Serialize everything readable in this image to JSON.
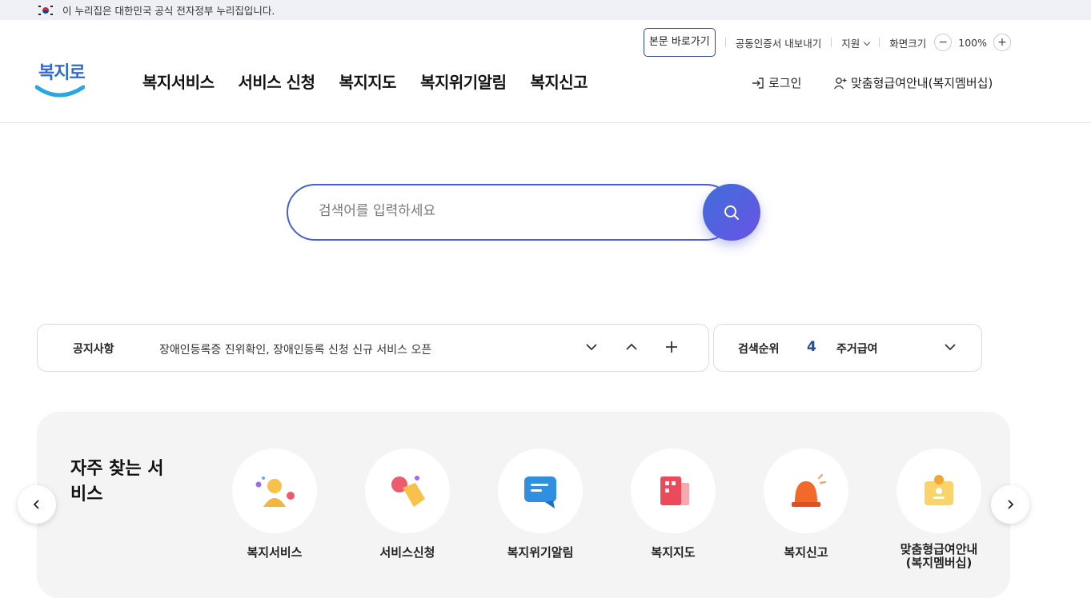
{
  "gov_banner": {
    "text": "이 누리집은 대한민국 공식 전자정부 누리집입니다."
  },
  "logo": {
    "text": "복지로"
  },
  "util": {
    "skip_label": "본문 바로가기",
    "cert_label": "공동인증서 내보내기",
    "support_label": "지원",
    "zoom_label": "화면크기",
    "zoom_out": "−",
    "zoom_value": "100%",
    "zoom_in": "+"
  },
  "nav": {
    "items": [
      {
        "label": "복지서비스"
      },
      {
        "label": "서비스 신청"
      },
      {
        "label": "복지지도"
      },
      {
        "label": "복지위기알림"
      },
      {
        "label": "복지신고"
      }
    ],
    "login_label": "로그인",
    "member_label": "맞춤형급여안내(복지멤버십)"
  },
  "search": {
    "placeholder": "검색어를 입력하세요"
  },
  "notice": {
    "label": "공지사항",
    "text": "장애인등록증 진위확인, 장애인등록 신청 신규 서비스 오픈"
  },
  "ranking": {
    "label": "검색순위",
    "rank": "4",
    "keyword": "주거급여"
  },
  "favorites": {
    "title": "자주 찾는 서비스",
    "items": [
      {
        "label": "복지서비스",
        "icon": "person-icon"
      },
      {
        "label": "서비스신청",
        "icon": "hand-click-icon"
      },
      {
        "label": "복지위기알림",
        "icon": "message-icon"
      },
      {
        "label": "복지지도",
        "icon": "map-building-icon"
      },
      {
        "label": "복지신고",
        "icon": "siren-icon"
      },
      {
        "label": "맞춤형급여안내\n(복지멤버십)",
        "icon": "id-badge-icon"
      }
    ]
  },
  "colors": {
    "primary": "#4a5fcf",
    "brand": "#2f6bd8",
    "panel": "#f4f4f5"
  }
}
